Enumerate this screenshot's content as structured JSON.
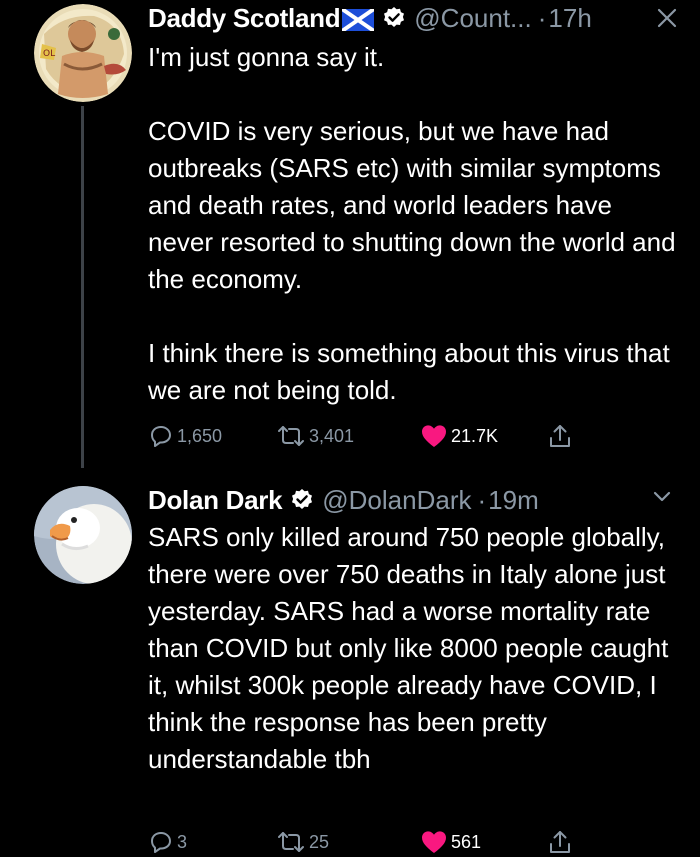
{
  "tweets": [
    {
      "display_name": "Daddy Scotland",
      "handle": "@Count...",
      "time": "17h",
      "text": "I'm just gonna say it.\n\nCOVID is very serious, but we have had outbreaks (SARS etc) with similar symptoms and death rates, and world leaders have never resorted to shutting down the world and the economy.\n\nI think there is something about this virus that we are not being told.",
      "replies": "1,650",
      "retweets": "3,401",
      "likes": "21.7K"
    },
    {
      "display_name": "Dolan Dark",
      "handle": "@DolanDark",
      "time": "19m",
      "text": "SARS only killed around 750 people globally, there were over 750 deaths in Italy alone just yesterday. SARS had a worse mortality rate than COVID but only like 8000 people caught it, whilst 300k people already have COVID, I think the response has been pretty understandable tbh",
      "replies": "3",
      "retweets": "25",
      "likes": "561"
    }
  ],
  "icons": {
    "flag": "scotland-flag-icon",
    "verified": "verified-badge-icon",
    "close": "close-icon",
    "chevron": "chevron-down-icon",
    "reply": "reply-icon",
    "retweet": "retweet-icon",
    "like": "heart-icon",
    "share": "share-icon"
  },
  "colors": {
    "background": "#000000",
    "text": "#ffffff",
    "secondary": "#8b98a5",
    "like_active": "#f91880",
    "verified": "#ffffff",
    "flag_blue": "#1d4ed8",
    "thread_line": "#3d4248"
  }
}
